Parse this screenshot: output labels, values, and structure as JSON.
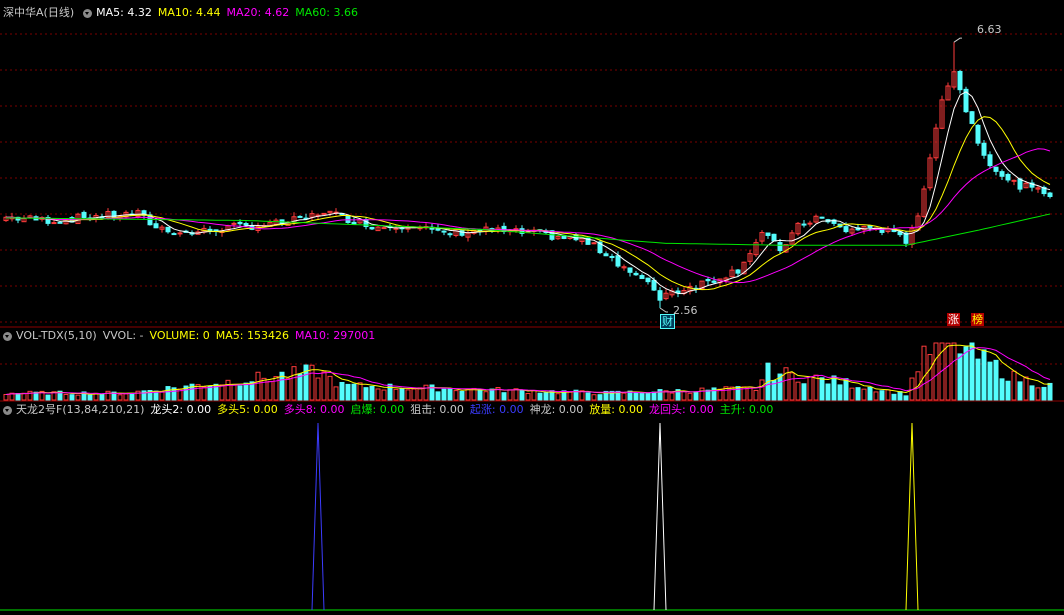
{
  "colors": {
    "up": "#ff3c3c",
    "down": "#54fcfc",
    "ma5": "#ffffff",
    "ma10": "#ffff00",
    "ma20": "#ff00ff",
    "ma60": "#00e600",
    "grid": "#7a0000",
    "divider": "#8b0000",
    "label": "#c8c8c8"
  },
  "price_panel": {
    "stock_name": "深中华A(日线)",
    "ma5": "MA5: 4.32",
    "ma10": "MA10: 4.44",
    "ma20": "MA20: 4.62",
    "ma60": "MA60: 3.66",
    "high_label": "6.63",
    "low_label": "2.56",
    "cai_badge": "财",
    "zhang_badge": "涨",
    "bang_badge": "榜"
  },
  "volume_panel": {
    "name": "VOL-TDX(5,10)",
    "vvol": "VVOL: -",
    "volume": "VOLUME: 0",
    "ma5": "MA5: 153426",
    "ma10": "MA10: 297001"
  },
  "indicator_panel": {
    "name": "天龙2号F(13,84,210,21)",
    "items": [
      {
        "label": "龙头2: 0.00",
        "color": "#ffffff"
      },
      {
        "label": "多头5: 0.00",
        "color": "#ffff00"
      },
      {
        "label": "多头8: 0.00",
        "color": "#ff00ff"
      },
      {
        "label": "启爆: 0.00",
        "color": "#00e600"
      },
      {
        "label": "狙击: 0.00",
        "color": "#c8c8c8"
      },
      {
        "label": "起涨: 0.00",
        "color": "#3c3cff"
      },
      {
        "label": "神龙: 0.00",
        "color": "#c8c8c8"
      },
      {
        "label": "放量: 0.00",
        "color": "#ffff00"
      },
      {
        "label": "龙回头: 0.00",
        "color": "#ff00ff"
      },
      {
        "label": "主升: 0.00",
        "color": "#00e600"
      }
    ],
    "spikes": [
      {
        "index": 52,
        "color": "#3c3cff"
      },
      {
        "index": 109,
        "color": "#ffffff"
      },
      {
        "index": 151,
        "color": "#ffff00"
      }
    ]
  },
  "chart_data": {
    "type": "candlestick",
    "ylim": [
      2.3,
      7.0
    ],
    "high": 6.63,
    "low": 2.56,
    "bars": 175,
    "price_anchors": [
      [
        0,
        3.95
      ],
      [
        8,
        3.9
      ],
      [
        15,
        3.97
      ],
      [
        22,
        4.0
      ],
      [
        25,
        3.8
      ],
      [
        30,
        3.7
      ],
      [
        38,
        3.8
      ],
      [
        45,
        3.85
      ],
      [
        50,
        3.93
      ],
      [
        53,
        4.05
      ],
      [
        56,
        3.95
      ],
      [
        62,
        3.8
      ],
      [
        68,
        3.85
      ],
      [
        72,
        3.7
      ],
      [
        80,
        3.75
      ],
      [
        88,
        3.7
      ],
      [
        96,
        3.6
      ],
      [
        100,
        3.4
      ],
      [
        105,
        3.05
      ],
      [
        109,
        2.78
      ],
      [
        112,
        2.83
      ],
      [
        118,
        3.0
      ],
      [
        122,
        3.15
      ],
      [
        126,
        3.7
      ],
      [
        129,
        3.45
      ],
      [
        132,
        3.8
      ],
      [
        135,
        3.95
      ],
      [
        140,
        3.75
      ],
      [
        145,
        3.8
      ],
      [
        150,
        3.6
      ],
      [
        152,
        4.0
      ],
      [
        154,
        4.8
      ],
      [
        156,
        5.8
      ],
      [
        158,
        6.2
      ],
      [
        160,
        5.6
      ],
      [
        163,
        4.9
      ],
      [
        167,
        4.5
      ],
      [
        172,
        4.35
      ],
      [
        174,
        4.32
      ]
    ],
    "volume_anchors": [
      [
        0,
        0.12
      ],
      [
        20,
        0.12
      ],
      [
        52,
        0.5
      ],
      [
        56,
        0.25
      ],
      [
        100,
        0.12
      ],
      [
        125,
        0.2
      ],
      [
        127,
        0.5
      ],
      [
        130,
        0.45
      ],
      [
        140,
        0.3
      ],
      [
        150,
        0.1
      ],
      [
        152,
        0.6
      ],
      [
        155,
        1.0
      ],
      [
        159,
        0.95
      ],
      [
        162,
        0.75
      ],
      [
        168,
        0.4
      ],
      [
        174,
        0.25
      ]
    ],
    "ma60_anchors": [
      [
        0,
        3.94
      ],
      [
        40,
        3.9
      ],
      [
        80,
        3.76
      ],
      [
        110,
        3.55
      ],
      [
        130,
        3.52
      ],
      [
        150,
        3.52
      ],
      [
        162,
        3.75
      ],
      [
        174,
        4.0
      ]
    ]
  }
}
